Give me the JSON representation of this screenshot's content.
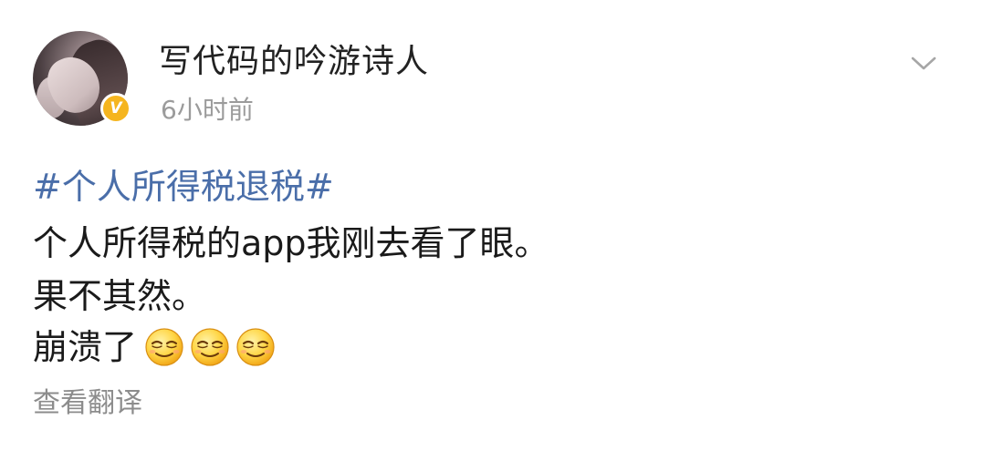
{
  "post": {
    "author": {
      "name": "写代码的吟游诗人",
      "verified_badge": "V",
      "badge_color": "#f5b51f"
    },
    "timestamp": "6小时前",
    "menu_icon": "chevron-down-icon",
    "topic": "#个人所得税退税#",
    "lines": [
      "个人所得税的app我刚去看了眼。",
      "果不其然。",
      "崩溃了"
    ],
    "emoji_icons": [
      "grin-squint-emoji-icon",
      "grin-squint-emoji-icon",
      "grin-squint-emoji-icon"
    ],
    "translate_label": "查看翻译",
    "colors": {
      "link": "#4a6ea9",
      "text": "#1a1a1a",
      "muted": "#9b9b9b"
    }
  }
}
